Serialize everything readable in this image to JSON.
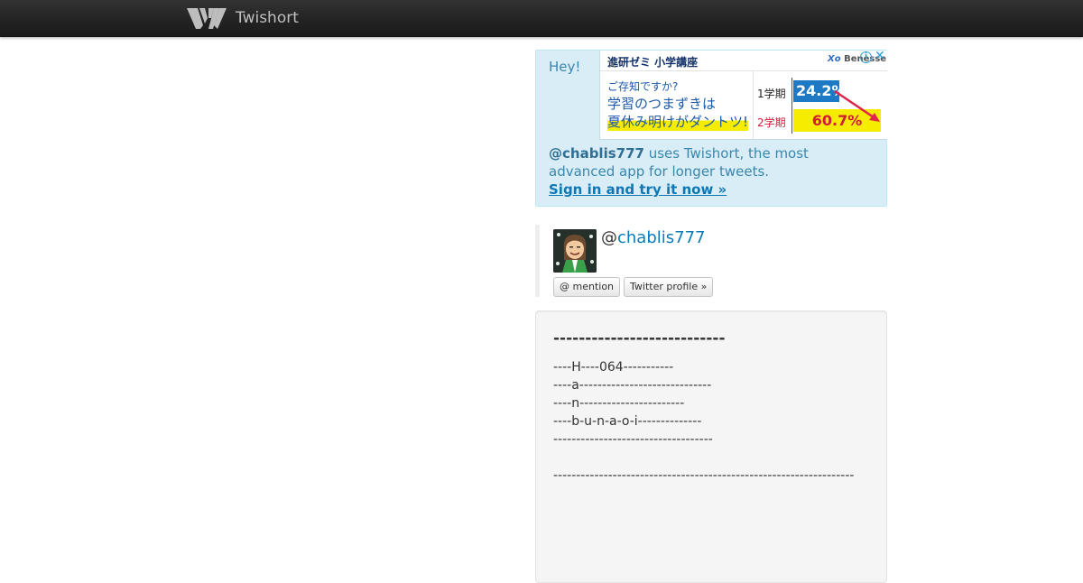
{
  "header": {
    "brand": "Twishort",
    "logo_icon": "twishort-wings-logo"
  },
  "hey_box": {
    "greeting": "Hey!",
    "handle": "@chablis777",
    "message": " uses Twishort, the most advanced app for longer tweets.",
    "signin": "Sign in and try it now »"
  },
  "ad": {
    "title": "進研ゼミ 小学講座",
    "logo": "Benesse",
    "logo_mark": "Xo",
    "info_icon": "info-icon",
    "close_icon": "close-icon",
    "question": "ご存知ですか?",
    "line1": "学習のつまずきは",
    "line2": "夏休み明けがダントツ!",
    "term1_label": "1学期",
    "term1_value": "24.2%",
    "term2_label": "2学期",
    "term2_value": "60.7%"
  },
  "profile": {
    "at": "@",
    "username": "chablis777",
    "mention_button": "@ mention",
    "twitter_button": "Twitter profile »"
  },
  "tweet": {
    "heading": "---------------------------",
    "lines": [
      "----H----064-----------",
      "----a-----------------------------",
      "----n-----------------------",
      "----b-u-n-a-o-i--------------",
      "-----------------------------------",
      "",
      "------------------------------------------------------------------"
    ]
  }
}
